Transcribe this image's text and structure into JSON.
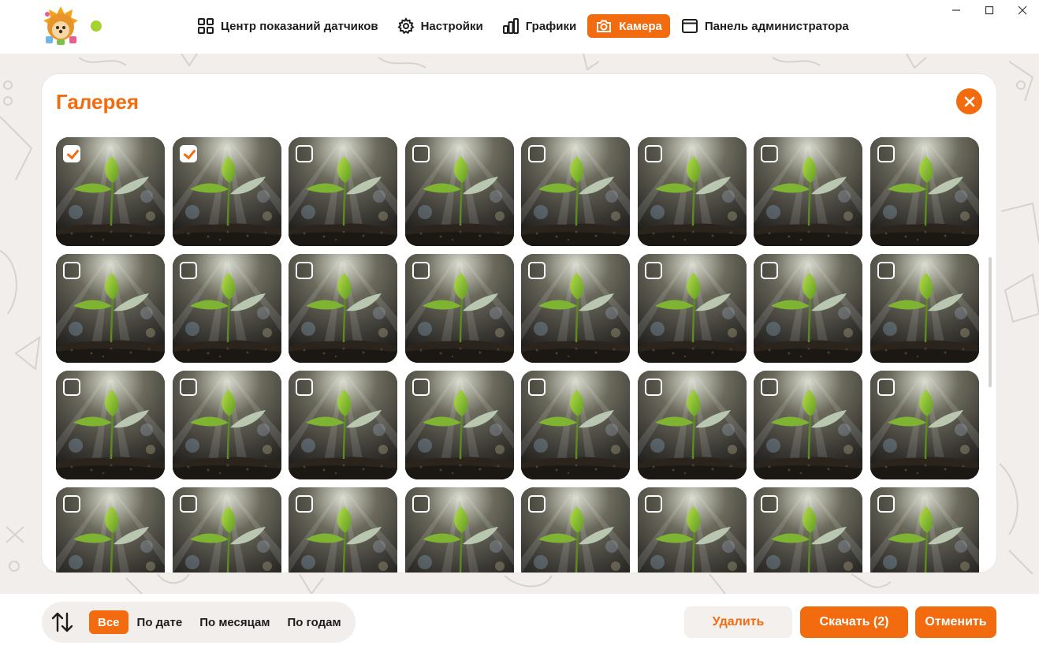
{
  "header": {
    "nav": [
      {
        "label": "Центр показаний датчиков",
        "icon": "grid-icon"
      },
      {
        "label": "Настройки",
        "icon": "gear-icon"
      },
      {
        "label": "Графики",
        "icon": "bar-chart-icon"
      },
      {
        "label": "Камера",
        "icon": "camera-icon",
        "active": true
      },
      {
        "label": "Панель администратора",
        "icon": "window-icon"
      }
    ],
    "status_color": "#a4d22e"
  },
  "gallery": {
    "title": "Галерея",
    "columns": 8,
    "photos": [
      {
        "checked": true
      },
      {
        "checked": true
      },
      {
        "checked": false
      },
      {
        "checked": false
      },
      {
        "checked": false
      },
      {
        "checked": false
      },
      {
        "checked": false
      },
      {
        "checked": false
      },
      {
        "checked": false
      },
      {
        "checked": false
      },
      {
        "checked": false
      },
      {
        "checked": false
      },
      {
        "checked": false
      },
      {
        "checked": false
      },
      {
        "checked": false
      },
      {
        "checked": false
      },
      {
        "checked": false
      },
      {
        "checked": false
      },
      {
        "checked": false
      },
      {
        "checked": false
      },
      {
        "checked": false
      },
      {
        "checked": false
      },
      {
        "checked": false
      },
      {
        "checked": false
      },
      {
        "checked": false
      },
      {
        "checked": false
      },
      {
        "checked": false
      },
      {
        "checked": false
      },
      {
        "checked": false
      },
      {
        "checked": false
      },
      {
        "checked": false
      },
      {
        "checked": false
      }
    ]
  },
  "footer": {
    "filters": [
      {
        "label": "Все",
        "active": true
      },
      {
        "label": "По дате",
        "active": false
      },
      {
        "label": "По месяцам",
        "active": false
      },
      {
        "label": "По годам",
        "active": false
      }
    ],
    "delete_label": "Удалить",
    "download_label": "Скачать (2)",
    "cancel_label": "Отменить"
  },
  "colors": {
    "accent": "#f26b0f",
    "background": "#f2eeeb"
  }
}
